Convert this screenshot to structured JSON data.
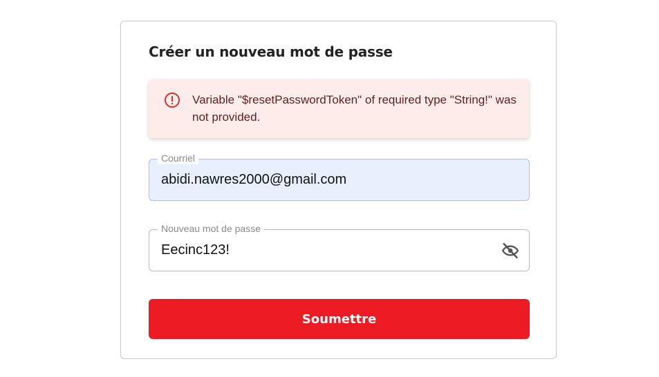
{
  "form": {
    "title": "Créer un nouveau mot de passe",
    "error": {
      "icon": "error-outline-icon",
      "message": "Variable \"$resetPasswordToken\" of required type \"String!\" was not provided.",
      "background_color": "#fdecea",
      "text_color": "#5f2120",
      "icon_color": "#d32f2f"
    },
    "email": {
      "label": "Courriel",
      "value": "abidi.nawres2000@gmail.com"
    },
    "password": {
      "label": "Nouveau mot de passe",
      "value": "Eecinc123!",
      "toggle_icon": "eye-off-icon"
    },
    "submit_label": "Soumettre",
    "accent_color": "#ed1c24"
  }
}
